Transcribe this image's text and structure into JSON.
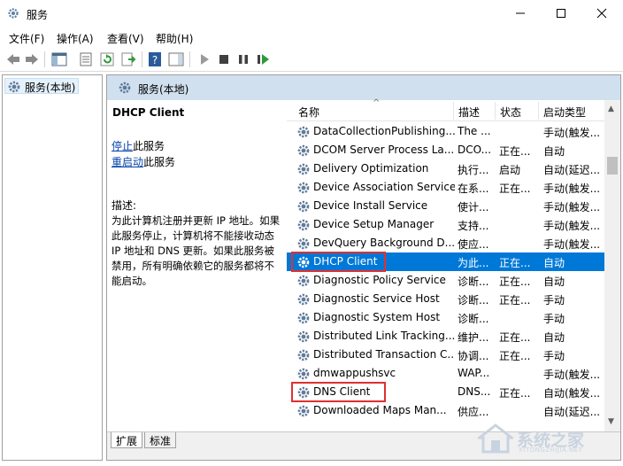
{
  "window": {
    "title": "服务"
  },
  "menu": [
    "文件(F)",
    "操作(A)",
    "查看(V)",
    "帮助(H)"
  ],
  "tree": {
    "root_label": "服务(本地)"
  },
  "panel": {
    "header": "服务(本地)"
  },
  "detail": {
    "service_name": "DHCP Client",
    "stop_link": "停止",
    "stop_suffix": "此服务",
    "restart_link": "重启动",
    "restart_suffix": "此服务",
    "desc_label": "描述:",
    "desc_lines": [
      "为此计算机注册并更新 IP 地址。如果",
      "此服务停止，计算机将不能接收动态",
      "IP 地址和 DNS 更新。如果此服务被",
      "禁用，所有明确依赖它的服务都将不",
      "能启动。"
    ]
  },
  "columns": {
    "name": "名称",
    "desc": "描述",
    "status": "状态",
    "startup": "启动类型"
  },
  "rows": [
    {
      "name": "DataCollectionPublishing...",
      "desc": "The ...",
      "status": "",
      "startup": "手动(触发..."
    },
    {
      "name": "DCOM Server Process La...",
      "desc": "DCO...",
      "status": "正在...",
      "startup": "自动"
    },
    {
      "name": "Delivery Optimization",
      "desc": "执行...",
      "status": "启动",
      "startup": "自动(延迟..."
    },
    {
      "name": "Device Association Service",
      "desc": "在系...",
      "status": "正在...",
      "startup": "手动(触发..."
    },
    {
      "name": "Device Install Service",
      "desc": "使计...",
      "status": "",
      "startup": "手动(触发..."
    },
    {
      "name": "Device Setup Manager",
      "desc": "支持...",
      "status": "",
      "startup": "手动(触发..."
    },
    {
      "name": "DevQuery Background D...",
      "desc": "使应...",
      "status": "",
      "startup": "手动(触发..."
    },
    {
      "name": "DHCP Client",
      "desc": "为此...",
      "status": "正在...",
      "startup": "自动",
      "selected": true,
      "highlight": true
    },
    {
      "name": "Diagnostic Policy Service",
      "desc": "诊断...",
      "status": "正在...",
      "startup": "自动"
    },
    {
      "name": "Diagnostic Service Host",
      "desc": "诊断...",
      "status": "正在...",
      "startup": "手动"
    },
    {
      "name": "Diagnostic System Host",
      "desc": "诊断...",
      "status": "",
      "startup": "手动"
    },
    {
      "name": "Distributed Link Tracking...",
      "desc": "维护...",
      "status": "正在...",
      "startup": "自动"
    },
    {
      "name": "Distributed Transaction C...",
      "desc": "协调...",
      "status": "正在...",
      "startup": "手动"
    },
    {
      "name": "dmwappushsvc",
      "desc": "WAP...",
      "status": "",
      "startup": "手动(触发..."
    },
    {
      "name": "DNS Client",
      "desc": "DNS...",
      "status": "正在...",
      "startup": "自动(触发...",
      "highlight": true
    },
    {
      "name": "Downloaded Maps Man...",
      "desc": "供应...",
      "status": "",
      "startup": "自动(延迟..."
    }
  ],
  "tabs": {
    "extended": "扩展",
    "standard": "标准"
  },
  "watermark": {
    "text": "系统之家",
    "sub": "XITONGZHIJIA.NET"
  },
  "colors": {
    "selection": "#0078d7",
    "highlight_box": "#e03030",
    "panel_header": "#d0e0ef"
  }
}
